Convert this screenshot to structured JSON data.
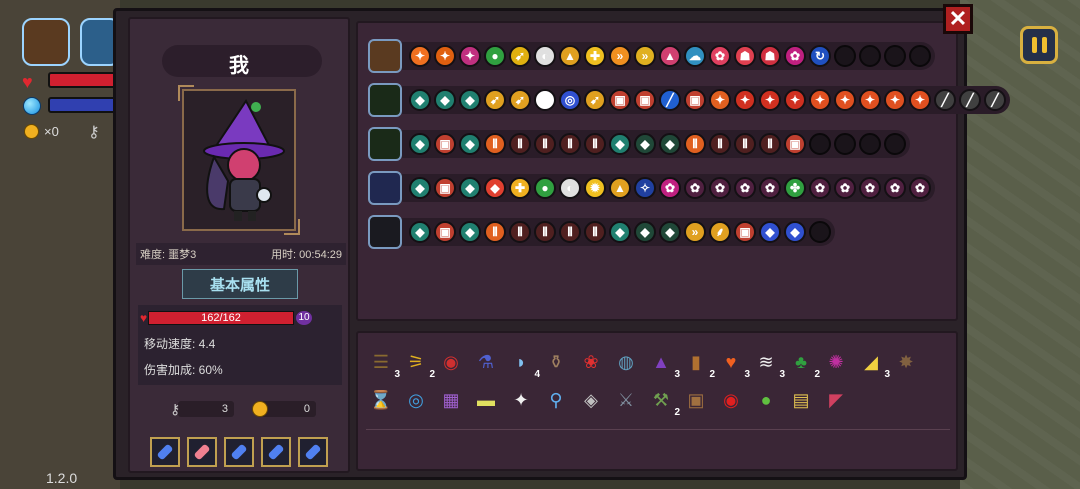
{
  "hud": {
    "coin_count": "×0",
    "version": "1.2.0"
  },
  "player": {
    "name": "我",
    "difficulty_label": "难度: 噩梦3",
    "time_label": "用时: 00:54:29",
    "section_title": "基本属性",
    "hp": "162/162",
    "level": "10",
    "move_speed": "移动速度: 4.4",
    "damage_bonus": "伤害加成: 60%",
    "keys": "3",
    "coins": "0"
  },
  "wands": [
    {
      "spells": [
        [
          "#f07020",
          "✦"
        ],
        [
          "#e06010",
          "✦"
        ],
        [
          "#c03080",
          "✦"
        ],
        [
          "#30a040",
          "●"
        ],
        [
          "#e0b010",
          "➹"
        ],
        [
          "#e0e0e0",
          "◐"
        ],
        [
          "#e0a020",
          "▲"
        ],
        [
          "#f0c020",
          "✚"
        ],
        [
          "#f09020",
          "»"
        ],
        [
          "#e0b020",
          "»"
        ],
        [
          "#d04070",
          "▲"
        ],
        [
          "#3090c0",
          "☁"
        ],
        [
          "#e04060",
          "✿"
        ],
        [
          "#e04050",
          "☗"
        ],
        [
          "#d03040",
          "☗"
        ],
        [
          "#c02080",
          "✿"
        ],
        [
          "#2050c0",
          "↻"
        ],
        [
          "",
          ""
        ],
        [
          "",
          ""
        ],
        [
          "",
          ""
        ],
        [
          "",
          ""
        ]
      ]
    },
    {
      "spells": [
        [
          "#208070",
          "◆"
        ],
        [
          "#208070",
          "◆"
        ],
        [
          "#208070",
          "◆"
        ],
        [
          "#e0a020",
          "➹"
        ],
        [
          "#e0a020",
          "➹"
        ],
        [
          "#ffffff",
          "◎"
        ],
        [
          "#3050d0",
          "◎"
        ],
        [
          "#e0a020",
          "➹"
        ],
        [
          "#c04030",
          "▣"
        ],
        [
          "#c04030",
          "▣"
        ],
        [
          "#2060d0",
          "╱"
        ],
        [
          "#c04030",
          "▣"
        ],
        [
          "#e06020",
          "✦"
        ],
        [
          "#d03020",
          "✦"
        ],
        [
          "#d03020",
          "✦"
        ],
        [
          "#d03020",
          "✦"
        ],
        [
          "#e05020",
          "✦"
        ],
        [
          "#e05020",
          "✦"
        ],
        [
          "#e05020",
          "✦"
        ],
        [
          "#e05020",
          "✦"
        ],
        [
          "#e05020",
          "✦"
        ],
        [
          "#404040",
          "╱"
        ],
        [
          "#404040",
          "╱"
        ],
        [
          "#404040",
          "╱"
        ]
      ]
    },
    {
      "spells": [
        [
          "#208070",
          "◆"
        ],
        [
          "#c04030",
          "▣"
        ],
        [
          "#208070",
          "◆"
        ],
        [
          "#e06020",
          "⦀"
        ],
        [
          "#502020",
          "⦀"
        ],
        [
          "#502020",
          "⦀"
        ],
        [
          "#502020",
          "⦀"
        ],
        [
          "#502020",
          "⦀"
        ],
        [
          "#208070",
          "◆"
        ],
        [
          "#204838",
          "◆"
        ],
        [
          "#204838",
          "◆"
        ],
        [
          "#e06020",
          "⦀"
        ],
        [
          "#502020",
          "⦀"
        ],
        [
          "#502020",
          "⦀"
        ],
        [
          "#502020",
          "⦀"
        ],
        [
          "#c04030",
          "▣"
        ],
        [
          "",
          ""
        ],
        [
          "",
          ""
        ],
        [
          "",
          ""
        ],
        [
          "",
          ""
        ]
      ]
    },
    {
      "spells": [
        [
          "#208070",
          "◆"
        ],
        [
          "#c04030",
          "▣"
        ],
        [
          "#208070",
          "◆"
        ],
        [
          "#e04030",
          "◆"
        ],
        [
          "#f0b020",
          "✚"
        ],
        [
          "#30a040",
          "●"
        ],
        [
          "#e0e0e0",
          "◐"
        ],
        [
          "#f0c020",
          "✹"
        ],
        [
          "#e0a020",
          "▲"
        ],
        [
          "#2040a0",
          "✧"
        ],
        [
          "#c02080",
          "✿"
        ],
        [
          "#502040",
          "✿"
        ],
        [
          "#502040",
          "✿"
        ],
        [
          "#502040",
          "✿"
        ],
        [
          "#502040",
          "✿"
        ],
        [
          "#30a040",
          "✤"
        ],
        [
          "#502040",
          "✿"
        ],
        [
          "#502040",
          "✿"
        ],
        [
          "#502040",
          "✿"
        ],
        [
          "#502040",
          "✿"
        ],
        [
          "#502040",
          "✿"
        ]
      ]
    },
    {
      "spells": [
        [
          "#208070",
          "◆"
        ],
        [
          "#c04030",
          "▣"
        ],
        [
          "#208070",
          "◆"
        ],
        [
          "#e06020",
          "⦀"
        ],
        [
          "#502020",
          "⦀"
        ],
        [
          "#502020",
          "⦀"
        ],
        [
          "#502020",
          "⦀"
        ],
        [
          "#502020",
          "⦀"
        ],
        [
          "#208070",
          "◆"
        ],
        [
          "#204838",
          "◆"
        ],
        [
          "#204838",
          "◆"
        ],
        [
          "#e0a020",
          "»"
        ],
        [
          "#e0a020",
          "⸙"
        ],
        [
          "#c04030",
          "▣"
        ],
        [
          "#3050d0",
          "◆"
        ],
        [
          "#3050d0",
          "◆"
        ],
        [
          "",
          ""
        ]
      ]
    }
  ],
  "items_row1": [
    {
      "icon": "☰",
      "color": "#8a6a30",
      "count": "3"
    },
    {
      "icon": "⚞",
      "color": "#e0b020",
      "count": "2"
    },
    {
      "icon": "◉",
      "color": "#d03030",
      "count": ""
    },
    {
      "icon": "⚗",
      "color": "#5060d0",
      "count": ""
    },
    {
      "icon": "◗",
      "color": "#80c0f0",
      "count": "4"
    },
    {
      "icon": "⚱",
      "color": "#a08060",
      "count": ""
    },
    {
      "icon": "❀",
      "color": "#e03030",
      "count": ""
    },
    {
      "icon": "◍",
      "color": "#60a0c0",
      "count": ""
    },
    {
      "icon": "▲",
      "color": "#8040c0",
      "count": "3"
    },
    {
      "icon": "▮",
      "color": "#b07030",
      "count": "2"
    },
    {
      "icon": "♥",
      "color": "#f06020",
      "count": "3"
    },
    {
      "icon": "≋",
      "color": "#f0f0f0",
      "count": "3"
    },
    {
      "icon": "♣",
      "color": "#30a040",
      "count": "2"
    },
    {
      "icon": "✺",
      "color": "#c030a0",
      "count": ""
    },
    {
      "icon": "◢",
      "color": "#f0d040",
      "count": "3"
    },
    {
      "icon": "✸",
      "color": "#806040",
      "count": ""
    }
  ],
  "items_row2": [
    {
      "icon": "⌛",
      "color": "#d0a040",
      "count": ""
    },
    {
      "icon": "◎",
      "color": "#40a0e0",
      "count": ""
    },
    {
      "icon": "▦",
      "color": "#a060d0",
      "count": ""
    },
    {
      "icon": "▬",
      "color": "#e0e060",
      "count": ""
    },
    {
      "icon": "✦",
      "color": "#f0f0f0",
      "count": ""
    },
    {
      "icon": "⚲",
      "color": "#60b0f0",
      "count": ""
    },
    {
      "icon": "◈",
      "color": "#c0c0c0",
      "count": ""
    },
    {
      "icon": "⚔",
      "color": "#8090a0",
      "count": ""
    },
    {
      "icon": "⚒",
      "color": "#70a050",
      "count": "2"
    },
    {
      "icon": "▣",
      "color": "#a07040",
      "count": ""
    },
    {
      "icon": "◉",
      "color": "#e02020",
      "count": ""
    },
    {
      "icon": "●",
      "color": "#60c040",
      "count": ""
    },
    {
      "icon": "▤",
      "color": "#e0c050",
      "count": ""
    },
    {
      "icon": "◤",
      "color": "#d04060",
      "count": ""
    }
  ]
}
